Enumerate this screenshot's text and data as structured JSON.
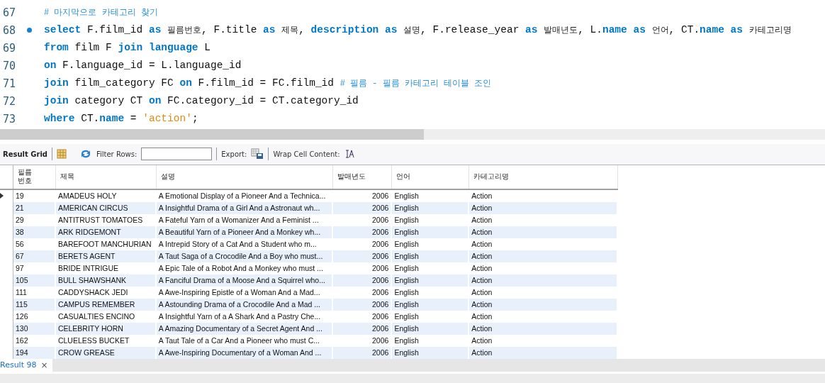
{
  "editor": {
    "lines": [
      {
        "number": "67",
        "marker": false,
        "tokens": [
          {
            "kind": "comment",
            "text": "# 마지막으로 카테고리 찾기"
          }
        ]
      },
      {
        "number": "68",
        "marker": true,
        "tokens": [
          {
            "kind": "kw",
            "text": "select"
          },
          {
            "kind": "plain",
            "text": " F.film_id "
          },
          {
            "kind": "kw",
            "text": "as "
          },
          {
            "kind": "alias",
            "text": "필름번호"
          },
          {
            "kind": "plain",
            "text": ", F.title "
          },
          {
            "kind": "kw",
            "text": "as "
          },
          {
            "kind": "alias",
            "text": "제목"
          },
          {
            "kind": "plain",
            "text": ", "
          },
          {
            "kind": "kw",
            "text": "description as "
          },
          {
            "kind": "alias",
            "text": "설명"
          },
          {
            "kind": "plain",
            "text": ", F.release_year "
          },
          {
            "kind": "kw",
            "text": "as "
          },
          {
            "kind": "alias",
            "text": "발매년도"
          },
          {
            "kind": "plain",
            "text": ", L."
          },
          {
            "kind": "kw",
            "text": "name as "
          },
          {
            "kind": "alias",
            "text": "언어"
          },
          {
            "kind": "plain",
            "text": ", CT."
          },
          {
            "kind": "kw",
            "text": "name as "
          },
          {
            "kind": "alias",
            "text": "카테고리명"
          }
        ]
      },
      {
        "number": "69",
        "marker": false,
        "tokens": [
          {
            "kind": "kw",
            "text": "from"
          },
          {
            "kind": "plain",
            "text": " film F "
          },
          {
            "kind": "kw",
            "text": "join language"
          },
          {
            "kind": "plain",
            "text": " L"
          }
        ]
      },
      {
        "number": "70",
        "marker": false,
        "tokens": [
          {
            "kind": "kw",
            "text": "on"
          },
          {
            "kind": "plain",
            "text": " F.language_id = L.language_id"
          }
        ]
      },
      {
        "number": "71",
        "marker": false,
        "tokens": [
          {
            "kind": "kw",
            "text": "join"
          },
          {
            "kind": "plain",
            "text": " film_category FC "
          },
          {
            "kind": "kw",
            "text": "on"
          },
          {
            "kind": "plain",
            "text": " F.film_id = FC.film_id "
          },
          {
            "kind": "comment",
            "text": "# 필름 - 필름 카테고리 테이블 조인"
          }
        ]
      },
      {
        "number": "72",
        "marker": false,
        "tokens": [
          {
            "kind": "kw",
            "text": "join"
          },
          {
            "kind": "plain",
            "text": " category CT "
          },
          {
            "kind": "kw",
            "text": "on"
          },
          {
            "kind": "plain",
            "text": " FC.category_id = CT.category_id"
          }
        ]
      },
      {
        "number": "73",
        "marker": false,
        "tokens": [
          {
            "kind": "kw",
            "text": "where"
          },
          {
            "kind": "plain",
            "text": " CT."
          },
          {
            "kind": "kw",
            "text": "name"
          },
          {
            "kind": "plain",
            "text": " = "
          },
          {
            "kind": "str",
            "text": "'action'"
          },
          {
            "kind": "plain",
            "text": ";"
          }
        ]
      }
    ]
  },
  "toolbar": {
    "result_grid": "Result Grid",
    "filter_label": "Filter Rows:",
    "export_label": "Export:",
    "wrap_label": "Wrap Cell Content:"
  },
  "table": {
    "columns": [
      "필름\n번호",
      "제목",
      "설명",
      "발매년도",
      "언어",
      "카테고리명"
    ],
    "rows": [
      {
        "selected": true,
        "cells": [
          "19",
          "AMADEUS HOLY",
          "A Emotional Display of a Pioneer And a Technica...",
          "2006",
          "English",
          "Action"
        ]
      },
      {
        "selected": false,
        "cells": [
          "21",
          "AMERICAN CIRCUS",
          "A Insightful Drama of a Girl And a Astronaut wh...",
          "2006",
          "English",
          "Action"
        ]
      },
      {
        "selected": false,
        "cells": [
          "29",
          "ANTITRUST TOMATOES",
          "A Fateful Yarn of a Womanizer And a Feminist ...",
          "2006",
          "English",
          "Action"
        ]
      },
      {
        "selected": false,
        "cells": [
          "38",
          "ARK RIDGEMONT",
          "A Beautiful Yarn of a Pioneer And a Monkey wh...",
          "2006",
          "English",
          "Action"
        ]
      },
      {
        "selected": false,
        "cells": [
          "56",
          "BAREFOOT MANCHURIAN",
          "A Intrepid Story of a Cat And a Student who m...",
          "2006",
          "English",
          "Action"
        ]
      },
      {
        "selected": false,
        "cells": [
          "67",
          "BERETS AGENT",
          "A Taut Saga of a Crocodile And a Boy who must...",
          "2006",
          "English",
          "Action"
        ]
      },
      {
        "selected": false,
        "cells": [
          "97",
          "BRIDE INTRIGUE",
          "A Epic Tale of a Robot And a Monkey who must ...",
          "2006",
          "English",
          "Action"
        ]
      },
      {
        "selected": false,
        "cells": [
          "105",
          "BULL SHAWSHANK",
          "A Fanciful Drama of a Moose And a Squirrel who...",
          "2006",
          "English",
          "Action"
        ]
      },
      {
        "selected": false,
        "cells": [
          "111",
          "CADDYSHACK JEDI",
          "A Awe-Inspiring Epistle of a Woman And a Mad...",
          "2006",
          "English",
          "Action"
        ]
      },
      {
        "selected": false,
        "cells": [
          "115",
          "CAMPUS REMEMBER",
          "A Astounding Drama of a Crocodile And a Mad ...",
          "2006",
          "English",
          "Action"
        ]
      },
      {
        "selected": false,
        "cells": [
          "126",
          "CASUALTIES ENCINO",
          "A Insightful Yarn of a A Shark And a Pastry Che...",
          "2006",
          "English",
          "Action"
        ]
      },
      {
        "selected": false,
        "cells": [
          "130",
          "CELEBRITY HORN",
          "A Amazing Documentary of a Secret Agent And ...",
          "2006",
          "English",
          "Action"
        ]
      },
      {
        "selected": false,
        "cells": [
          "162",
          "CLUELESS BUCKET",
          "A Taut Tale of a Car And a Pioneer who must C...",
          "2006",
          "English",
          "Action"
        ]
      },
      {
        "selected": false,
        "cells": [
          "194",
          "CROW GREASE",
          "A Awe-Inspiring Documentary of a Woman And ...",
          "2006",
          "English",
          "Action"
        ]
      }
    ]
  },
  "result_tabs": [
    {
      "label": "Result 98",
      "close": "×",
      "selected": true
    }
  ]
}
